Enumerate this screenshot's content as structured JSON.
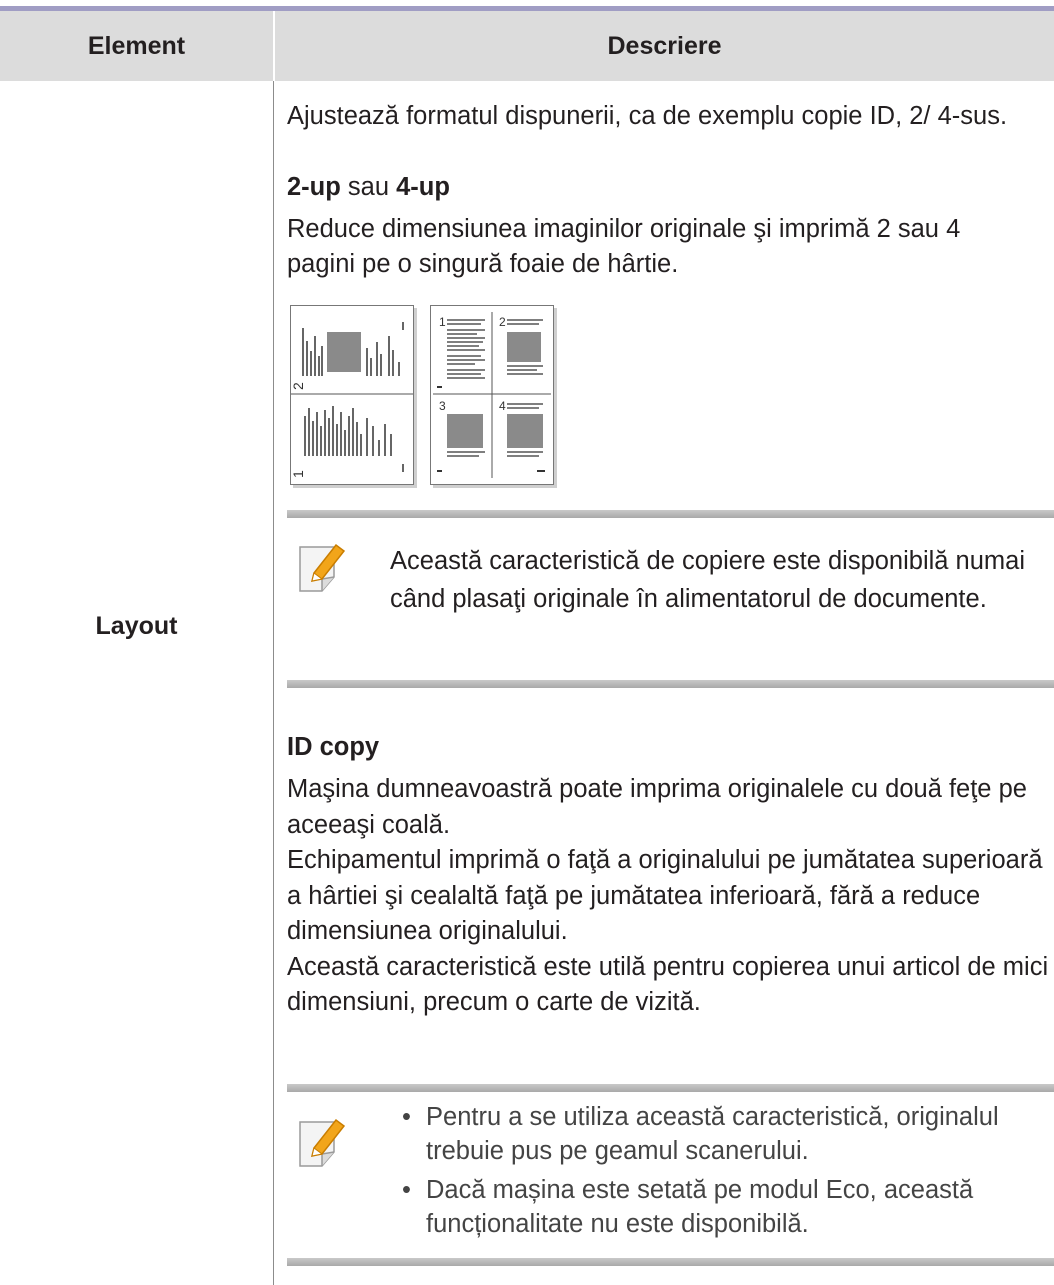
{
  "table": {
    "header": {
      "element": "Element",
      "description": "Descriere"
    },
    "row": {
      "element": "Layout",
      "intro": "Ajustează formatul dispunerii, ca de exemplu copie ID, 2/ 4-sus.",
      "two_up": {
        "opt_a": "2-up",
        "joiner": " sau ",
        "opt_b": "4-up",
        "text": "Reduce dimensiunea imaginilor originale şi imprimă 2 sau 4 pagini pe o singură foaie de hârtie.",
        "figure_numbers": [
          "1",
          "2",
          "3",
          "4"
        ]
      },
      "note1": "Această caracteristică de copiere este disponibilă numai când plasaţi originale în alimentatorul de documente.",
      "id_copy": {
        "title": "ID copy",
        "text": "Maşina dumneavoastră poate imprima originalele cu două feţe pe aceeaşi coală.\nEchipamentul imprimă o faţă a originalului pe jumătatea superioară a hârtiei şi cealaltă faţă pe jumătatea inferioară, fără a reduce dimensiunea originalului.\nAceastă caracteristică este utilă pentru copierea unui articol de mici dimensiuni, precum o carte de vizită."
      },
      "note2": [
        "Pentru a se utiliza această caracteristică, originalul trebuie pus pe geamul scanerului.",
        "Dacă mașina este setată pe modul Eco, această funcționalitate nu este disponibilă."
      ]
    }
  },
  "colors": {
    "header_bg": "#dcdcdc",
    "top_rule": "#a09dc4",
    "note_bar": "#b5b5b5",
    "note_icon": "#f2a51a"
  },
  "icons": [
    "note-pencil-icon"
  ]
}
